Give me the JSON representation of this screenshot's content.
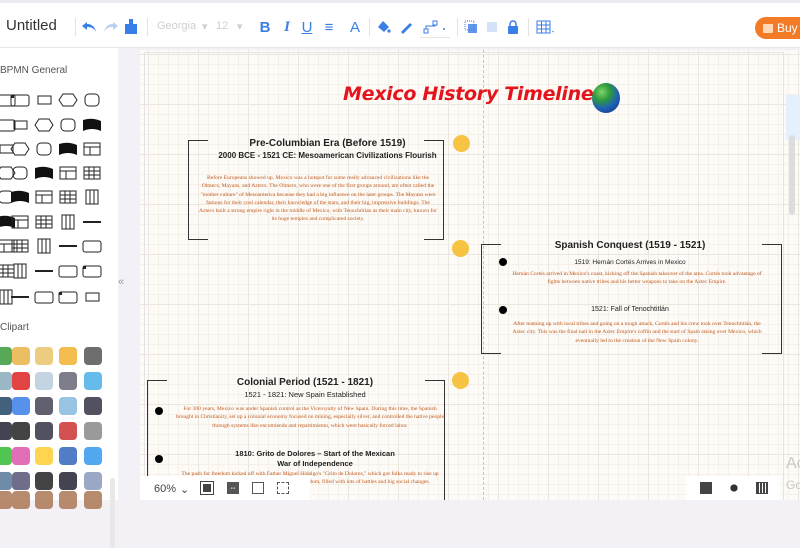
{
  "app": {
    "title": "Untitled",
    "buy_label": "Buy"
  },
  "toolbar": {
    "font_family": "Georgia",
    "font_size": "12",
    "bold": "B",
    "italic": "I",
    "underline": "U",
    "align": "≡",
    "font_color": "A",
    "icons": [
      "undo-icon",
      "redo-icon",
      "format-painter-icon",
      "bold-icon",
      "italic-icon",
      "underline-icon",
      "align-icon",
      "font-color-icon",
      "fill-color-icon",
      "line-color-icon",
      "connector-style-icon",
      "bring-front-icon",
      "send-back-icon",
      "lock-icon",
      "table-icon"
    ]
  },
  "sidebar": {
    "section_bpmn": "BPMN General",
    "section_clipart": "Clipart",
    "collapse_label": "«"
  },
  "diagram": {
    "title": "Mexico History Timeline",
    "eras": [
      {
        "title": "Pre-Columbian Era (Before 1519)",
        "events": [
          {
            "heading": "2000 BCE - 1521 CE: Mesoamerican Civilizations Flourish",
            "body": "Before Europeans showed up, Mexico was a hotspot for some really advanced civilizations like the Olmecs, Mayans, and Aztecs. The Olmecs, who were one of the first groups around, are often called the \"mother culture\" of Mesoamerica because they had a big influence on the later groups. The Mayans were famous for their cool calendar, their knowledge of the stars, and their big, impressive buildings. The Aztecs built a strong empire right in the middle of Mexico, with Tenochtitlan as their main city, known for its huge temples and complicated society."
          }
        ]
      },
      {
        "title": "Spanish Conquest (1519 - 1521)",
        "events": [
          {
            "heading": "1519: Hernán Cortés Arrives in Mexico",
            "body": "Hernán Cortés arrived in Mexico's coast, kicking off the Spanish takeover of the area. Cortés took advantage of fights between native tribes and his better weapons to take on the Aztec Empire."
          },
          {
            "heading": "1521: Fall of Tenochtitlán",
            "body": "After teaming up with local tribes and going on a tough attack, Cortés and his crew took over Tenochtitlán, the Aztec city. This was the final nail in the Aztec Empire's coffin and the start of Spain taking over Mexico, which eventually led to the creation of the New Spain colony."
          }
        ]
      },
      {
        "title": "Colonial Period (1521 - 1821)",
        "events": [
          {
            "heading": "1521 - 1821: New Spain Established",
            "body": "For 300 years, Mexico was under Spanish control as the Viceroyalty of New Spain. During this time, the Spanish brought in Christianity, set up a colonial economy focused on mining, especially silver, and controlled the native people through systems like encomienda and repartimiento, which were basically forced labor."
          },
          {
            "heading": "1810: Grito de Dolores – Start of the Mexican War of Independence",
            "body": "The push for freedom kicked off with Father Miguel Hidalgo's \"Grito de Dolores,\" which got folks ready to rise up against Spain. This led to a decade-long fight for freedom, filled with lots of battles and big social changes."
          }
        ]
      }
    ]
  },
  "zoombar": {
    "zoom_level": "60%"
  },
  "watermark": {
    "line1": "Ac",
    "line2": "Go"
  }
}
